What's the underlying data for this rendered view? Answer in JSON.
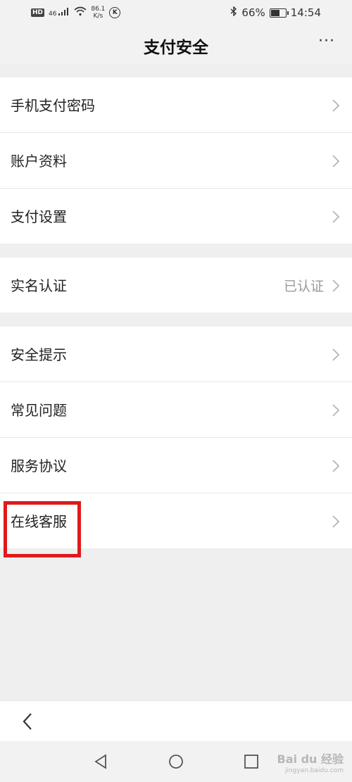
{
  "status_bar": {
    "hd": "HD",
    "signal": "46",
    "speed_value": "86.1",
    "speed_unit": "K/s",
    "k_badge": "K",
    "bluetooth_icon": "bluetooth-icon",
    "battery_percent": "66%",
    "battery_level": 0.66,
    "time": "14:54"
  },
  "header": {
    "title": "支付安全",
    "more_label": "···"
  },
  "groups": [
    {
      "rows": [
        {
          "label": "手机支付密码",
          "value": ""
        },
        {
          "label": "账户资料",
          "value": ""
        },
        {
          "label": "支付设置",
          "value": ""
        }
      ]
    },
    {
      "rows": [
        {
          "label": "实名认证",
          "value": "已认证"
        }
      ]
    },
    {
      "rows": [
        {
          "label": "安全提示",
          "value": ""
        },
        {
          "label": "常见问题",
          "value": ""
        },
        {
          "label": "服务协议",
          "value": ""
        },
        {
          "label": "在线客服",
          "value": ""
        }
      ]
    }
  ],
  "highlight": {
    "target": "在线客服",
    "color": "#e0191b"
  },
  "watermark": {
    "text": "Bai du 经验",
    "sub": "jingyan.baidu.com"
  },
  "colors": {
    "background": "#efefef",
    "row_background": "#ffffff",
    "value_text": "#9a9a9a"
  }
}
